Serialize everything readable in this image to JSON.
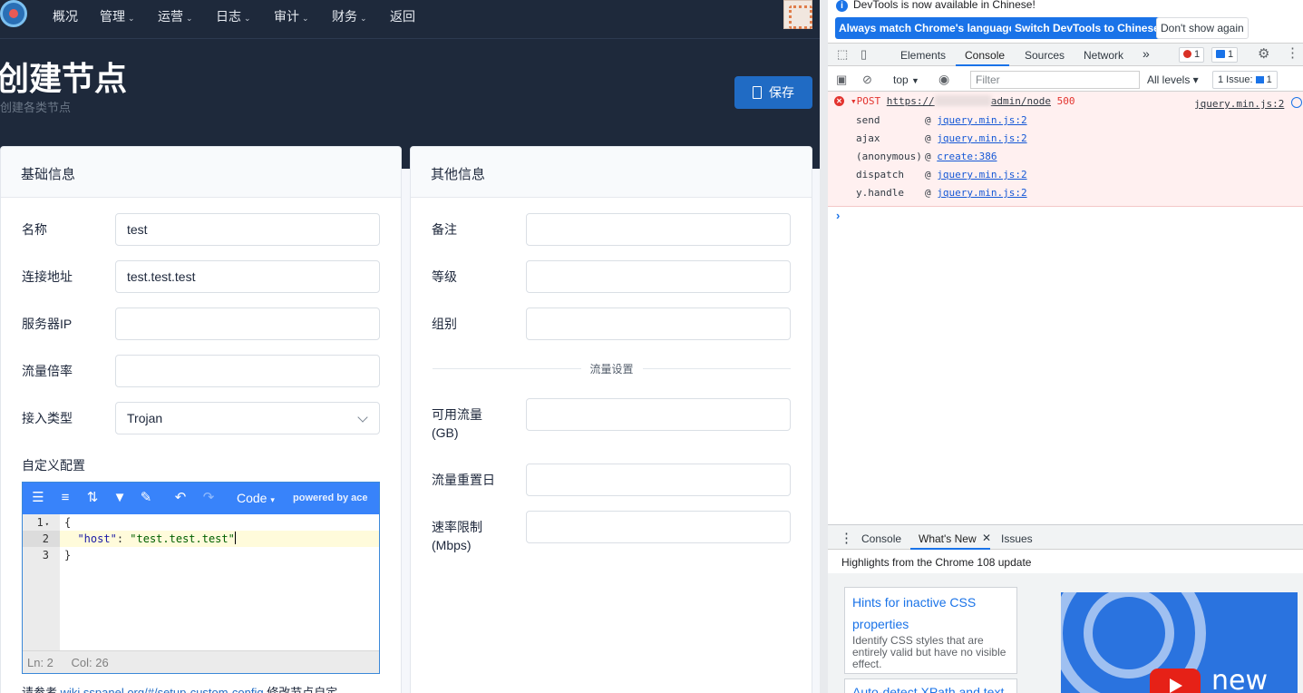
{
  "nav": {
    "items": [
      "概况",
      "管理",
      "运营",
      "日志",
      "审计",
      "财务",
      "返回"
    ],
    "caret": "⌄"
  },
  "page": {
    "title": "创建节点",
    "subtitle": "创建各类节点",
    "save_label": "保存"
  },
  "basic": {
    "header": "基础信息",
    "name_label": "名称",
    "name_value": "test",
    "address_label": "连接地址",
    "address_value": "test.test.test",
    "ip_label": "服务器IP",
    "ip_value": "",
    "rate_label": "流量倍率",
    "rate_value": "",
    "type_label": "接入类型",
    "type_value": "Trojan",
    "custom_label": "自定义配置"
  },
  "editor": {
    "mode": "Code",
    "mode_caret": "▾",
    "powered": "powered by ace",
    "line_numbers": [
      "1",
      "2",
      "3"
    ],
    "line1": "{",
    "line2_key": "\"host\"",
    "line2_colon": ": ",
    "line2_value": "\"test.test.test\"",
    "line3": "}",
    "status_ln": "Ln: 2",
    "status_col": "Col: 26"
  },
  "help": {
    "prefix": "请参考 ",
    "link": "wiki.sspanel.org/#/setup-custom-config",
    "suffix": " 修改节点自定"
  },
  "other": {
    "header": "其他信息",
    "remark_label": "备注",
    "level_label": "等级",
    "group_label": "组别",
    "traffic_divider": "流量设置",
    "available_label_1": "可用流量",
    "available_label_2": "(GB)",
    "reset_label": "流量重置日",
    "speed_label_1": "速率限制",
    "speed_label_2": "(Mbps)"
  },
  "devtools": {
    "info_text": "DevTools is now available in Chinese!",
    "btn_match": "Always match Chrome's language",
    "btn_switch": "Switch DevTools to Chinese",
    "btn_dismiss": "Don't show again",
    "tabs": [
      "Elements",
      "Console",
      "Sources",
      "Network"
    ],
    "more": "»",
    "error_count": "1",
    "message_count": "1",
    "context": "top",
    "filter_placeholder": "Filter",
    "levels": "All levels ▾",
    "issues": "1 Issue:",
    "issue_count": "1",
    "error": {
      "method": "POST",
      "url_start": "https://",
      "url_end": "admin/node",
      "status": "500",
      "source": "jquery.min.js:2"
    },
    "stack": [
      {
        "fn": "send",
        "src": "jquery.min.js:2"
      },
      {
        "fn": "ajax",
        "src": "jquery.min.js:2"
      },
      {
        "fn": "(anonymous)",
        "src": "create:386"
      },
      {
        "fn": "dispatch",
        "src": "jquery.min.js:2"
      },
      {
        "fn": "y.handle",
        "src": "jquery.min.js:2"
      }
    ],
    "drawer_tabs": [
      "Console",
      "What's New",
      "Issues"
    ],
    "whats_new_title": "Highlights from the Chrome 108 update",
    "card1_title_1": "Hints for inactive CSS",
    "card1_title_2": "properties",
    "card1_desc": "Identify CSS styles that are entirely valid but have no visible effect.",
    "card2_title": "Auto-detect XPath and text",
    "video_text": "new"
  },
  "colors": {
    "hero_bg": "#1e293b",
    "primary": "#206bc4",
    "ace_bar": "#3883fa",
    "devtools_blue": "#1a73e8",
    "error_red": "#e3342f",
    "error_bg": "#fff0f0"
  }
}
